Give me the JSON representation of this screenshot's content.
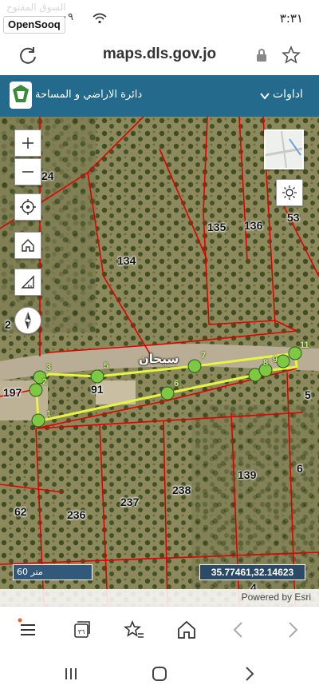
{
  "status_bar": {
    "time": "٣:٣١",
    "left_text": "٠٩",
    "watermark_ar": "السوق المفتوح",
    "watermark_logo": "OpenSooq"
  },
  "browser": {
    "url": "maps.dls.gov.jo"
  },
  "app_header": {
    "tools_label": "اداوات",
    "department": "دائرة الاراضي و المساحة"
  },
  "map": {
    "parcels": [
      "24",
      "135",
      "136",
      "53",
      "134",
      "2",
      "197",
      "91",
      "5",
      "139",
      "6",
      "238",
      "237",
      "62",
      "236",
      "4"
    ],
    "road_name": "سيحان",
    "waypoints": [
      "1",
      "2",
      "3",
      "4",
      "5",
      "6",
      "7",
      "8",
      "9",
      "10",
      "11"
    ],
    "scale": "60 متر",
    "coordinates": "35.77461,32.14623",
    "attribution": "Powered by Esri"
  },
  "icons": {
    "reload": "reload-icon",
    "lock": "lock-icon",
    "bookmark": "star-icon",
    "zoom_in": "plus-icon",
    "zoom_out": "minus-icon",
    "locate": "crosshair-icon",
    "home": "home-icon",
    "measure": "ruler-icon",
    "compass": "compass-icon",
    "basemap": "brightness-icon",
    "menu": "menu-icon",
    "tabs": "tabs-icon",
    "favorites": "star-list-icon",
    "browser_home": "home-icon",
    "back": "chevron-left-icon",
    "forward": "chevron-right-icon"
  },
  "colors": {
    "header": "#246a8c",
    "parcel_lines": "#e00000",
    "measure_line": "#e6f542",
    "waypoint": "#7ec844"
  }
}
